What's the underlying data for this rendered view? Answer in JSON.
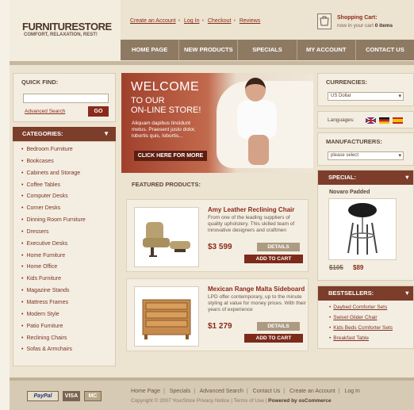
{
  "header": {
    "logo": "FURNITURESTORE",
    "tagline": "COMFORT, RELAXATION, REST!",
    "top_links": [
      "Create an Account",
      "Log In",
      "Checkout",
      "Reviews"
    ],
    "cart_title": "Shopping Cart:",
    "cart_text": "now in your cart",
    "cart_count": "0 items"
  },
  "nav": [
    "HOME PAGE",
    "NEW PRODUCTS",
    "SPECIALS",
    "MY ACCOUNT",
    "CONTACT US"
  ],
  "quick_find": {
    "title": "QUICK FIND:",
    "input_value": "",
    "advanced": "Advanced Search",
    "go": "GO"
  },
  "categories": {
    "title": "CATEGORIES:",
    "items": [
      "Bedroom Furniture",
      "Bookcases",
      "Cabinets and Storage",
      "Coffee Tables",
      "Computer Desks",
      "Corner Desks",
      "Dinning Room Furniture",
      "Dressers",
      "Executive Desks",
      "Home Furniture",
      "Home Office",
      "Kids Furniture",
      "Magazine Stands",
      "Mattress Frames",
      "Modern Style",
      "Patio Furniture",
      "Reclining Chairs",
      "Sofas & Armchairs"
    ]
  },
  "banner": {
    "welcome": "WELCOME",
    "line2": "TO OUR",
    "line3": "ON-LINE STORE!",
    "text": "Aliquam dapibus tincidunt metus. Praesent justo dolor, lobortis quis, lobortis...",
    "button": "CLICK HERE FOR MORE"
  },
  "featured": {
    "title": "FEATURED PRODUCTS:",
    "products": [
      {
        "name": "Amy Leather Reclining Chair",
        "desc": "From one of the leading suppliers of quality upholstery. This skilled team of innovative designers and craftmen",
        "price": "$3 599",
        "details": "DETAILS",
        "add": "ADD TO CART"
      },
      {
        "name": "Mexican Range Malta Sideboard",
        "desc": "LPD offer contemporary, up to the minute styling at value for money prices. With their years of experience",
        "price": "$1 279",
        "details": "DETAILS",
        "add": "ADD TO CART"
      }
    ]
  },
  "currencies": {
    "title": "CURRENCIES:",
    "selected": "US Dollar"
  },
  "languages": {
    "label": "Languages:"
  },
  "manufacturers": {
    "title": "MANUFACTURERS:",
    "selected": "please select"
  },
  "special": {
    "title": "SPECIAL:",
    "name": "Novaro Padded",
    "old_price": "$105",
    "new_price": "$89"
  },
  "bestsellers": {
    "title": "BESTSELLERS:",
    "items": [
      "Daybed Comforter Sets",
      "Swivel Glider Chair",
      "Kids Beds Comforter Sets",
      "Breakfast Table"
    ]
  },
  "footer": {
    "links": [
      "Home Page",
      "Specials",
      "Advanced Search",
      "Contact Us",
      "Create an Account",
      "Log In"
    ],
    "copyright": "Copyright © 2007 YourStore   Privacy Notice | Terms of Use |",
    "powered": "Powered by osCommerce",
    "payments": [
      "PayPal",
      "VISA",
      "MC"
    ]
  },
  "colors": {
    "accent": "#8a2a1a",
    "nav": "#8e7a63",
    "header_bar": "#7c3d2b"
  }
}
